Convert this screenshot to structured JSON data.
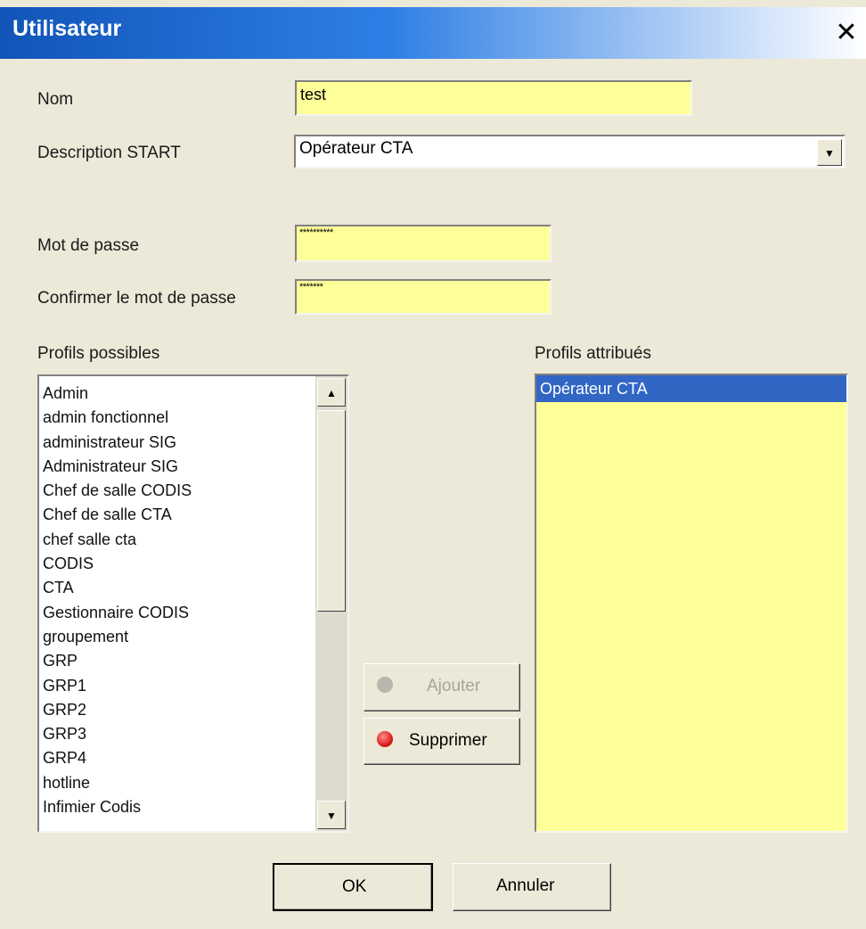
{
  "window": {
    "title": "Utilisateur",
    "close_glyph": "✕"
  },
  "fields": {
    "nom_label": "Nom",
    "nom_value": "test",
    "description_label": "Description START",
    "description_value": "Opérateur CTA",
    "password_label": "Mot de passe",
    "password_value": "**********",
    "confirm_label": "Confirmer le mot de passe",
    "confirm_value": "*******"
  },
  "profils_possibles": {
    "label": "Profils possibles",
    "items": [
      "Admin",
      "admin fonctionnel",
      "administrateur SIG",
      "Administrateur SIG",
      "Chef de salle CODIS",
      "Chef de salle CTA",
      "chef salle cta",
      "CODIS",
      "CTA",
      "Gestionnaire CODIS",
      "groupement",
      "GRP",
      "GRP1",
      "GRP2",
      "GRP3",
      "GRP4",
      "hotline",
      "Infimier Codis"
    ]
  },
  "profils_attribues": {
    "label": "Profils attribués",
    "items": [
      "Opérateur CTA"
    ]
  },
  "buttons": {
    "ajouter": "Ajouter",
    "supprimer": "Supprimer",
    "ok": "OK",
    "annuler": "Annuler"
  },
  "colors": {
    "title_start": "#1155b8",
    "field_yellow": "#ffff99",
    "selection_blue": "#3166c5",
    "dialog_bg": "#ece9d8"
  },
  "icons": {
    "add": "plus-circle-icon",
    "remove": "remove-circle-icon",
    "dropdown": "chevron-down-icon"
  }
}
